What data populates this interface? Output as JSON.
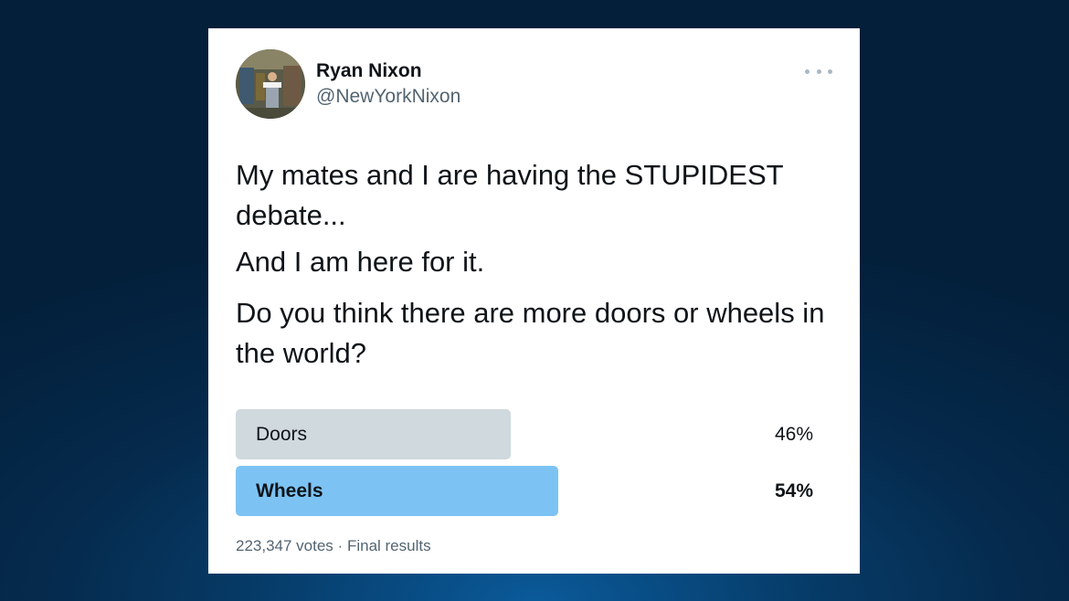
{
  "author": {
    "name": "Ryan Nixon",
    "handle": "@NewYorkNixon"
  },
  "tweet": {
    "lines": [
      "My mates and I are having the STUPIDEST debate...",
      "And I am here for it.",
      "Do you think there are more doors or wheels in the world?"
    ]
  },
  "poll": {
    "options": [
      {
        "label": "Doors",
        "percent_text": "46%",
        "percent": 46
      },
      {
        "label": "Wheels",
        "percent_text": "54%",
        "percent": 54
      }
    ],
    "votes": "223,347 votes",
    "separator": "·",
    "status": "Final results"
  },
  "icons": {
    "more": "more-options-icon"
  }
}
